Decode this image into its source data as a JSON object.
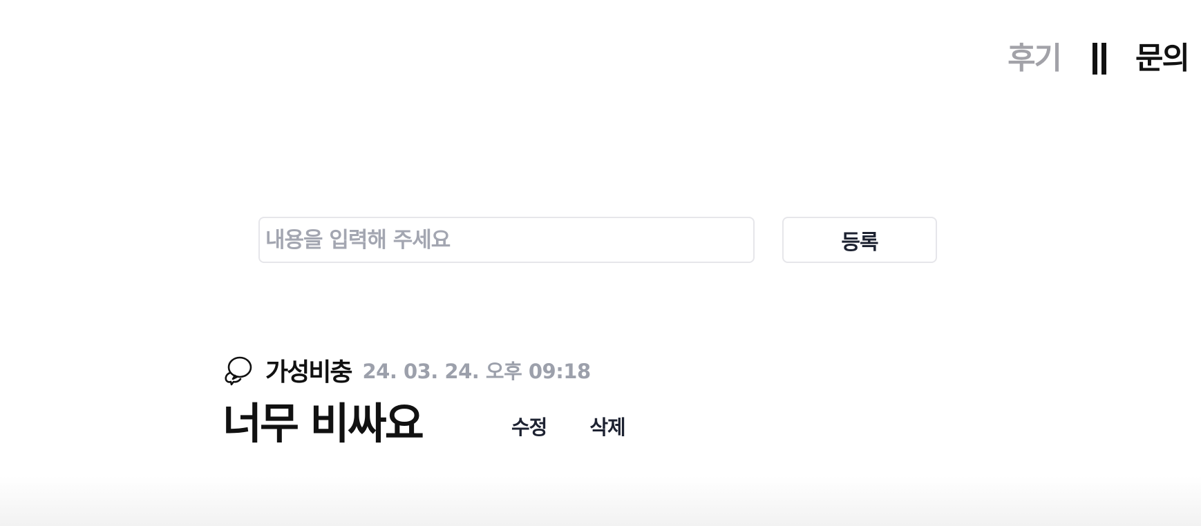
{
  "tabs": {
    "review_label": "후기",
    "inquiry_label": "문의"
  },
  "form": {
    "placeholder": "내용을 입력해 주세요",
    "value": "",
    "submit_label": "등록"
  },
  "review": {
    "author": "가성비충",
    "timestamp": "24. 03. 24. 오후 09:18",
    "text": "너무 비싸요",
    "edit_label": "수정",
    "delete_label": "삭제",
    "icon": "chat-bubble-icon"
  }
}
